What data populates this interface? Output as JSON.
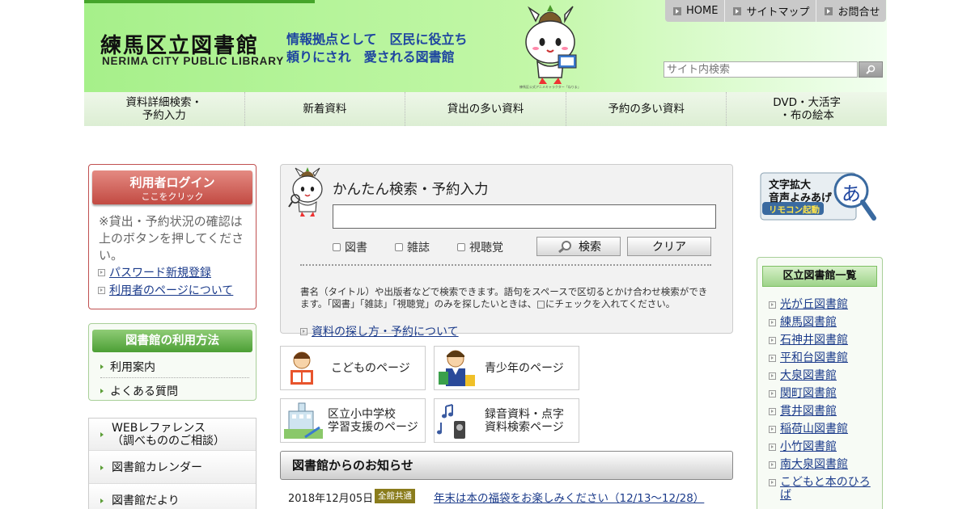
{
  "header": {
    "logo_jp": "練馬区立図書館",
    "logo_en": "NERIMA CITY PUBLIC LIBRARY",
    "slogan_line1": "情報拠点として　区民に役立ち",
    "slogan_line2": "頼りにされ　愛される図書館",
    "mascot_caption": "練馬区公式アニメキャラクター「ねりま」",
    "top_links": [
      "HOME",
      "サイトマップ",
      "お問合せ"
    ],
    "search_placeholder": "サイト内検索"
  },
  "nav": {
    "items": [
      "資料詳細検索・\n予約入力",
      "新着資料",
      "貸出の多い資料",
      "予約の多い資料",
      "DVD・大活字\n・布の絵本"
    ]
  },
  "login": {
    "button_line1": "利用者ログイン",
    "button_line2": "ここをクリック",
    "note": "※貸出・予約状況の確認は上のボタンを押してください。",
    "password_link": "パスワード新規登録",
    "user_page_link": "利用者のページについて"
  },
  "usage": {
    "title": "図書館の利用方法",
    "links": [
      "利用案内",
      "よくある質問"
    ]
  },
  "side_menu": {
    "items": [
      "WEBレファレンス\n（調べもののご相談）",
      "図書館カレンダー",
      "図書館だより"
    ]
  },
  "search": {
    "title": "かんたん検索・予約入力",
    "input_value": "",
    "checkboxes": [
      "図書",
      "雑誌",
      "視聴覚"
    ],
    "search_button": "検索",
    "clear_button": "クリア",
    "help": "書名（タイトル）や出版者などで検索できます。語句をスペースで区切るとかけ合わせ検索ができます。「図書」「雑誌」「視聴覚」のみを探したいときは、□にチェックを入れてください。",
    "how_link": "資料の探し方・予約について"
  },
  "tiles": {
    "kids": "こどものページ",
    "teens": "青少年のページ",
    "school": "区立小中学校\n学習支援のページ",
    "audio": "録音資料・点字\n資料検索ページ"
  },
  "notice": {
    "title": "図書館からのお知らせ",
    "date": "2018年12月05日",
    "badge": "全館共通",
    "link": "年末は本の福袋をお楽しみください（12/13～12/28）"
  },
  "remote": {
    "line1": "文字拡大",
    "line2": "音声よみあげ",
    "line3": "リモコン起動",
    "glyph": "あ"
  },
  "branches": {
    "title": "区立図書館一覧",
    "items": [
      "光が丘図書館",
      "練馬図書館",
      "石神井図書館",
      "平和台図書館",
      "大泉図書館",
      "関町図書館",
      "貫井図書館",
      "稲荷山図書館",
      "小竹図書館",
      "南大泉図書館",
      "こどもと本のひろば"
    ]
  },
  "colors": {
    "header_green": "#a6f08a",
    "login_red": "#c24a42",
    "usage_green": "#4c9f35",
    "link_blue": "#1a3a8a",
    "slogan_blue": "#1f46a0"
  }
}
